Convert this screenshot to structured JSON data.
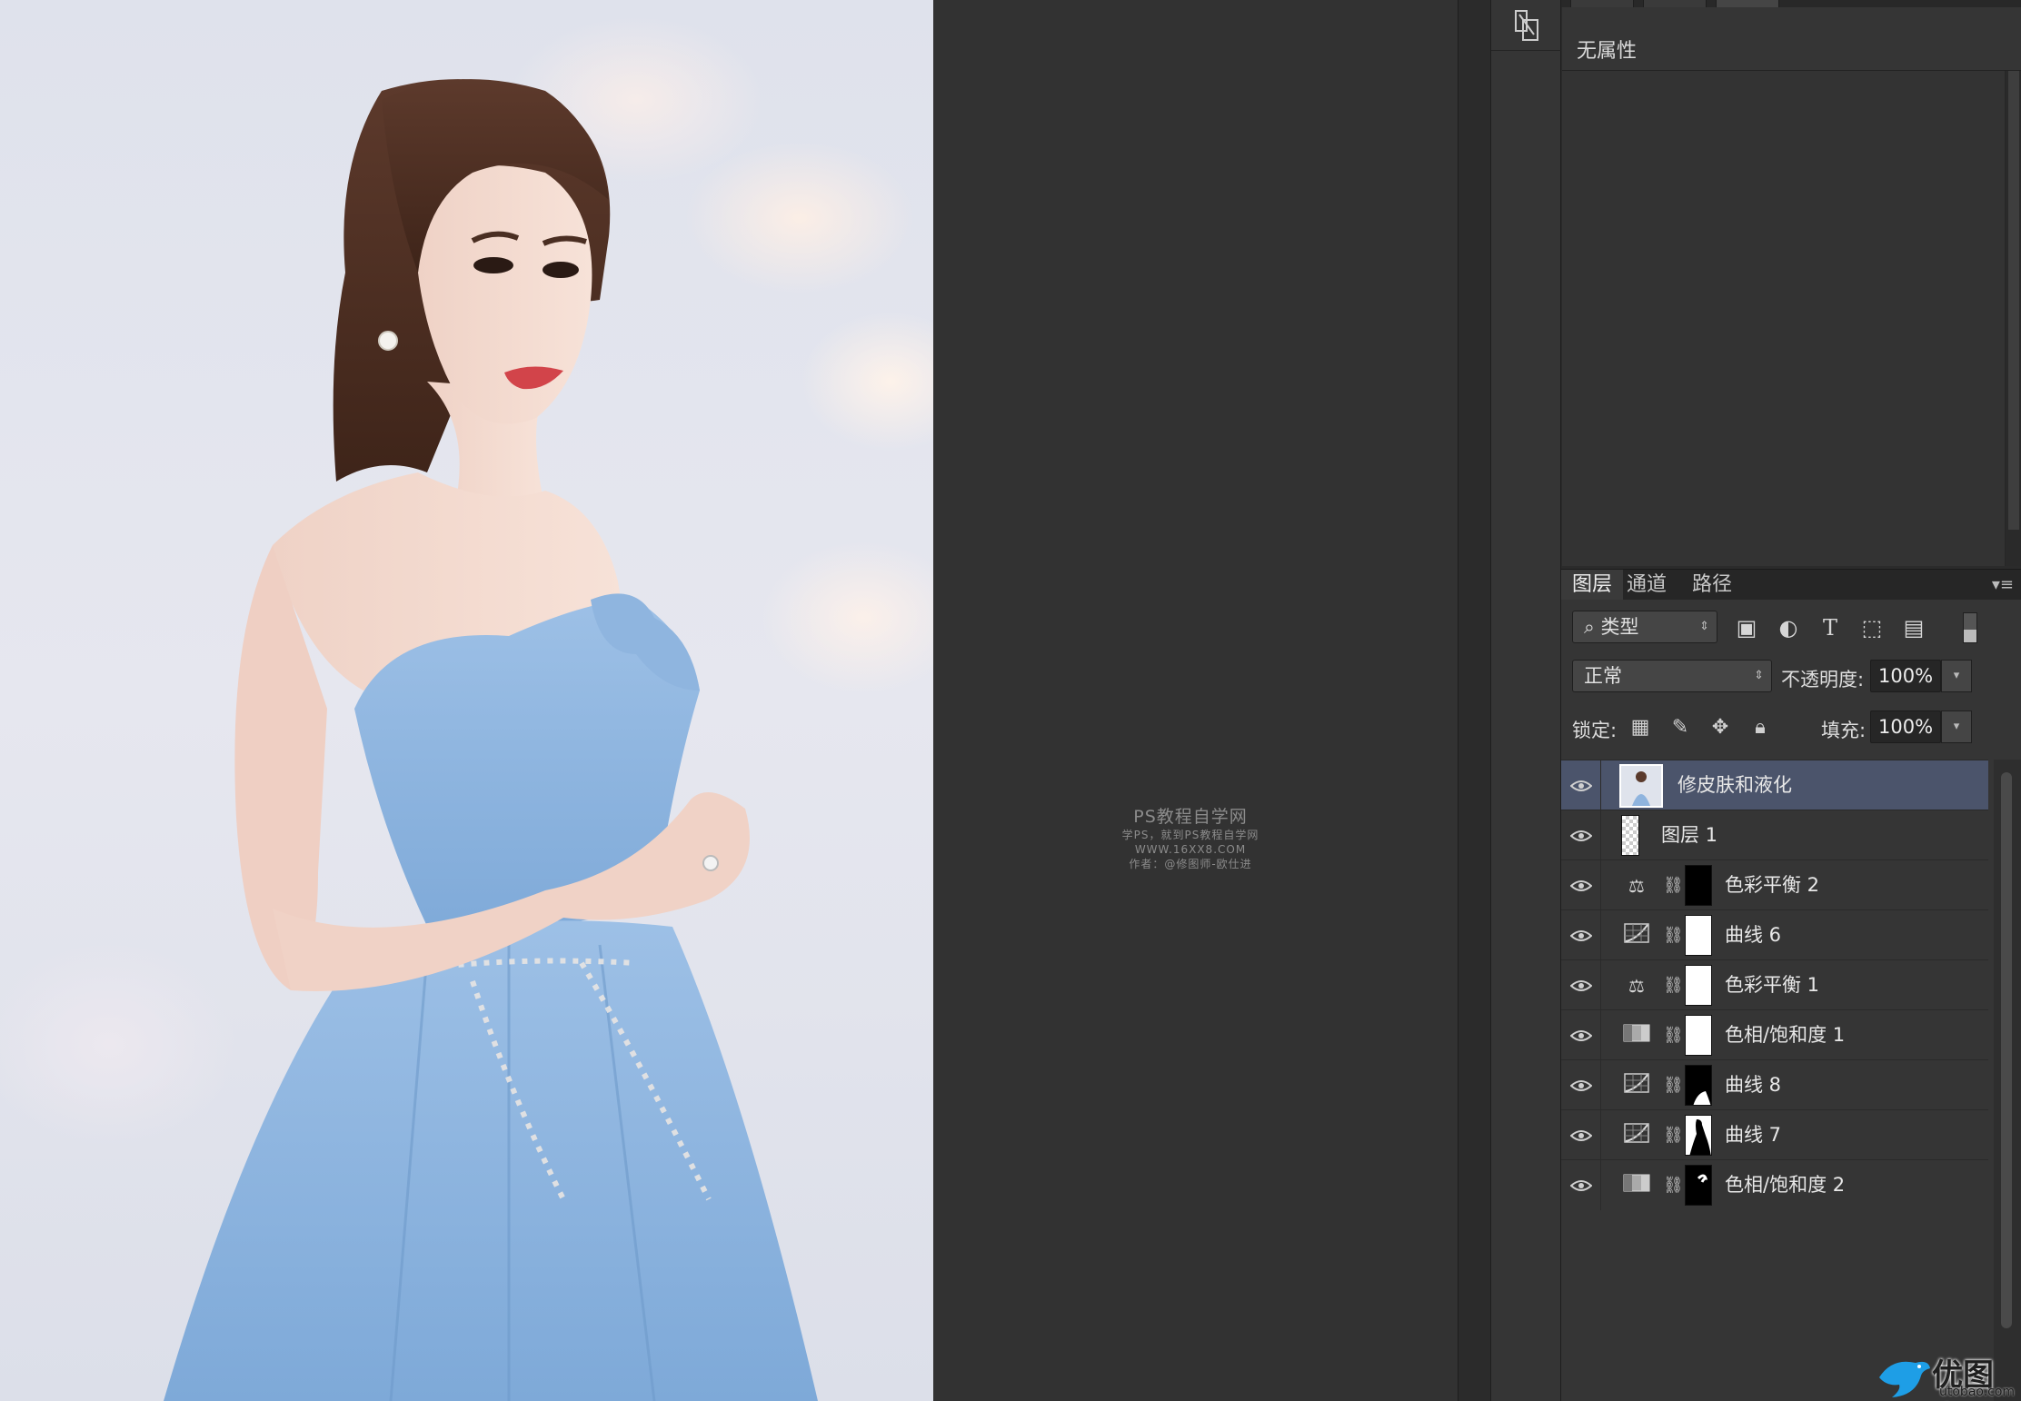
{
  "properties_panel": {
    "title": "无属性"
  },
  "layers_panel": {
    "tabs": [
      "图层",
      "通道",
      "路径"
    ],
    "active_tab": "图层",
    "filter": {
      "label": "类型"
    },
    "blend_mode": "正常",
    "opacity_label": "不透明度:",
    "opacity_value": "100%",
    "lock_label": "锁定:",
    "fill_label": "填充:",
    "fill_value": "100%",
    "layers": [
      {
        "name": "修皮肤和液化",
        "type": "photo",
        "selected": true
      },
      {
        "name": "图层 1",
        "type": "empty"
      },
      {
        "name": "色彩平衡 2",
        "type": "color-balance",
        "mask": "black"
      },
      {
        "name": "曲线 6",
        "type": "curves",
        "mask": "white"
      },
      {
        "name": "色彩平衡 1",
        "type": "color-balance",
        "mask": "white"
      },
      {
        "name": "色相/饱和度 1",
        "type": "hue-saturation",
        "mask": "white"
      },
      {
        "name": "曲线 8",
        "type": "curves",
        "mask": "black"
      },
      {
        "name": "曲线 7",
        "type": "curves",
        "mask": "white"
      },
      {
        "name": "色相/饱和度 2",
        "type": "hue-saturation",
        "mask": "black"
      }
    ]
  },
  "watermark": {
    "line1": "PS教程自学网",
    "line2": "学PS，就到PS教程自学网",
    "line3": "WWW.16XX8.COM",
    "line4": "作者：@修图师-欧仕进"
  },
  "logo": {
    "name": "优图宝",
    "url": "utobao.com"
  },
  "colors": {
    "selected_layer": "#4b546b",
    "panel_bg": "#353535",
    "canvas_bg": "#323232"
  }
}
